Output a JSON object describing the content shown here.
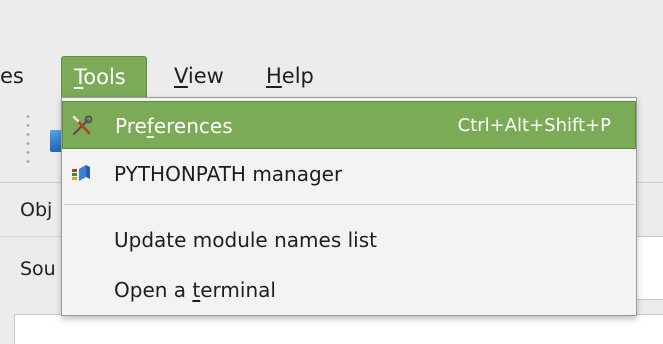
{
  "menubar": {
    "items": [
      {
        "label": "es"
      },
      {
        "pre": "",
        "mnemonic": "T",
        "post": "ools"
      },
      {
        "pre": "",
        "mnemonic": "V",
        "post": "iew"
      },
      {
        "pre": "",
        "mnemonic": "H",
        "post": "elp"
      }
    ]
  },
  "side_labels": {
    "objects": "Obj",
    "source": "Sou"
  },
  "tools_menu": {
    "items": [
      {
        "pre": "Pre",
        "mnemonic": "f",
        "post": "erences",
        "shortcut": "Ctrl+Alt+Shift+P",
        "icon": "wrench-screwdriver-icon",
        "highlighted": true
      },
      {
        "label": "PYTHONPATH manager",
        "icon": "pythonpath-icon"
      },
      {
        "label": "Update module names list"
      },
      {
        "pre": "Open a ",
        "mnemonic": "t",
        "post": "erminal"
      }
    ]
  },
  "colors": {
    "highlight": "#7cab58",
    "menu_background": "#f3f3f3"
  }
}
